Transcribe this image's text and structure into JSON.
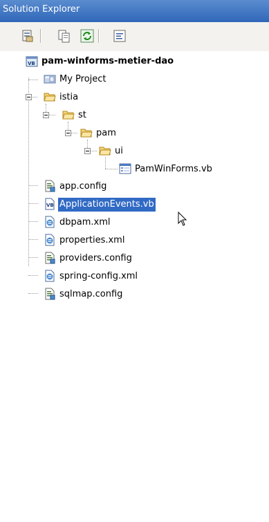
{
  "window": {
    "title": "Solution Explorer"
  },
  "toolbar": {
    "buttons": [
      {
        "icon": "properties-icon"
      },
      {
        "icon": "show-all-files-icon"
      },
      {
        "icon": "refresh-icon"
      },
      {
        "icon": "view-code-icon"
      }
    ]
  },
  "tree": {
    "nodes": [
      {
        "label": "pam-winforms-metier-dao",
        "icon": "vb-project-icon",
        "expanded": true
      },
      {
        "label": "My Project",
        "icon": "my-project-icon"
      },
      {
        "label": "istia",
        "icon": "folder-icon",
        "expanded": true
      },
      {
        "label": "st",
        "icon": "folder-icon",
        "expanded": true
      },
      {
        "label": "pam",
        "icon": "folder-icon",
        "expanded": true
      },
      {
        "label": "ui",
        "icon": "folder-icon",
        "expanded": true
      },
      {
        "label": "PamWinForms.vb",
        "icon": "form-icon"
      },
      {
        "label": "app.config",
        "icon": "config-file-icon"
      },
      {
        "label": "ApplicationEvents.vb",
        "icon": "vb-file-icon",
        "selected": true
      },
      {
        "label": "dbpam.xml",
        "icon": "xml-file-icon"
      },
      {
        "label": "properties.xml",
        "icon": "xml-file-icon"
      },
      {
        "label": "providers.config",
        "icon": "config-file-icon"
      },
      {
        "label": "spring-config.xml",
        "icon": "xml-file-icon"
      },
      {
        "label": "sqlmap.config",
        "icon": "config-file-icon"
      }
    ]
  }
}
